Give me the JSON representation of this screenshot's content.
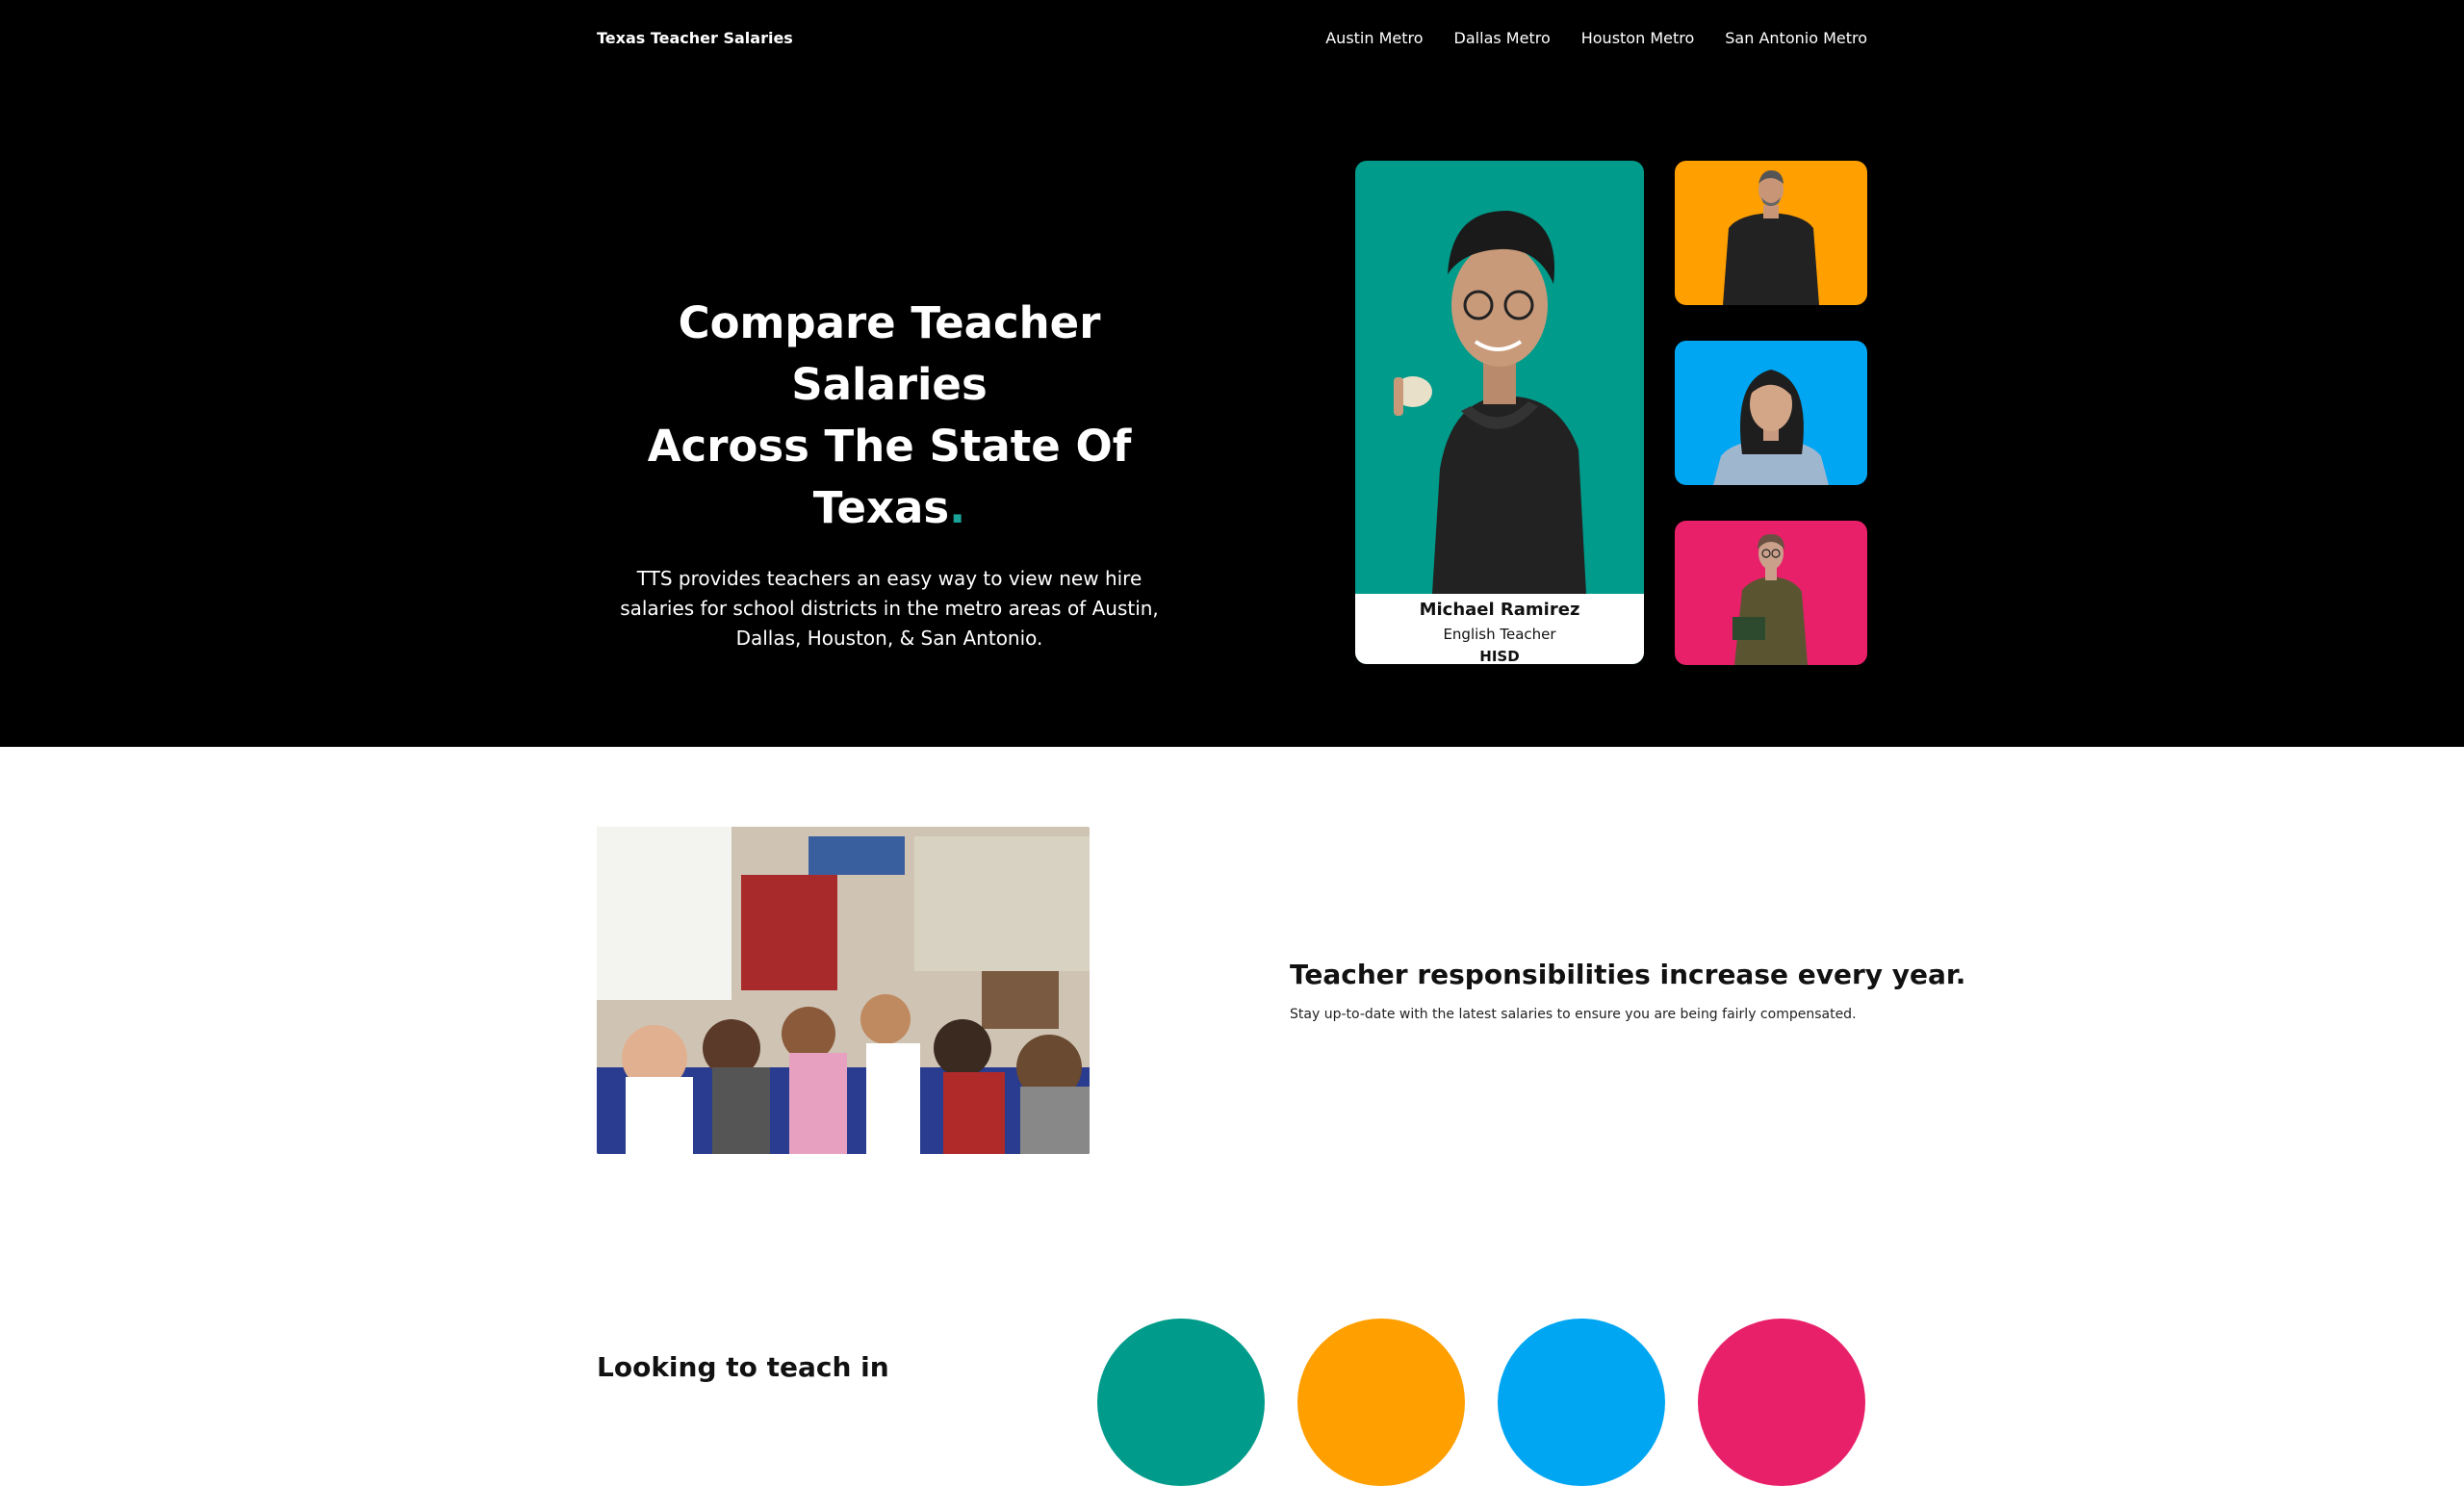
{
  "site": {
    "brand": "Texas Teacher Salaries"
  },
  "nav": {
    "items": [
      {
        "label": "Austin Metro"
      },
      {
        "label": "Dallas Metro"
      },
      {
        "label": "Houston Metro"
      },
      {
        "label": "San Antonio Metro"
      }
    ]
  },
  "hero": {
    "title_line1": "Compare Teacher Salaries",
    "title_line2": "Across The State Of Texas",
    "title_dot": ".",
    "subtitle": "TTS provides teachers an easy way to view new hire salaries for school districts in the metro areas of Austin, Dallas, Houston, & San Antonio."
  },
  "featured_teacher": {
    "name": "Michael Ramirez",
    "role": "English Teacher",
    "district": "HISD"
  },
  "responsibilities": {
    "title": "Teacher responsibilities increase every year.",
    "subtitle": "Stay up-to-date with the latest salaries to ensure you are being fairly compensated."
  },
  "metros_section": {
    "title": "Looking to teach in"
  },
  "colors": {
    "teal": "#009b8a",
    "orange": "#ff9f00",
    "blue": "#00a6f2",
    "pink": "#e8206a",
    "accent_dot": "#1aa399"
  }
}
